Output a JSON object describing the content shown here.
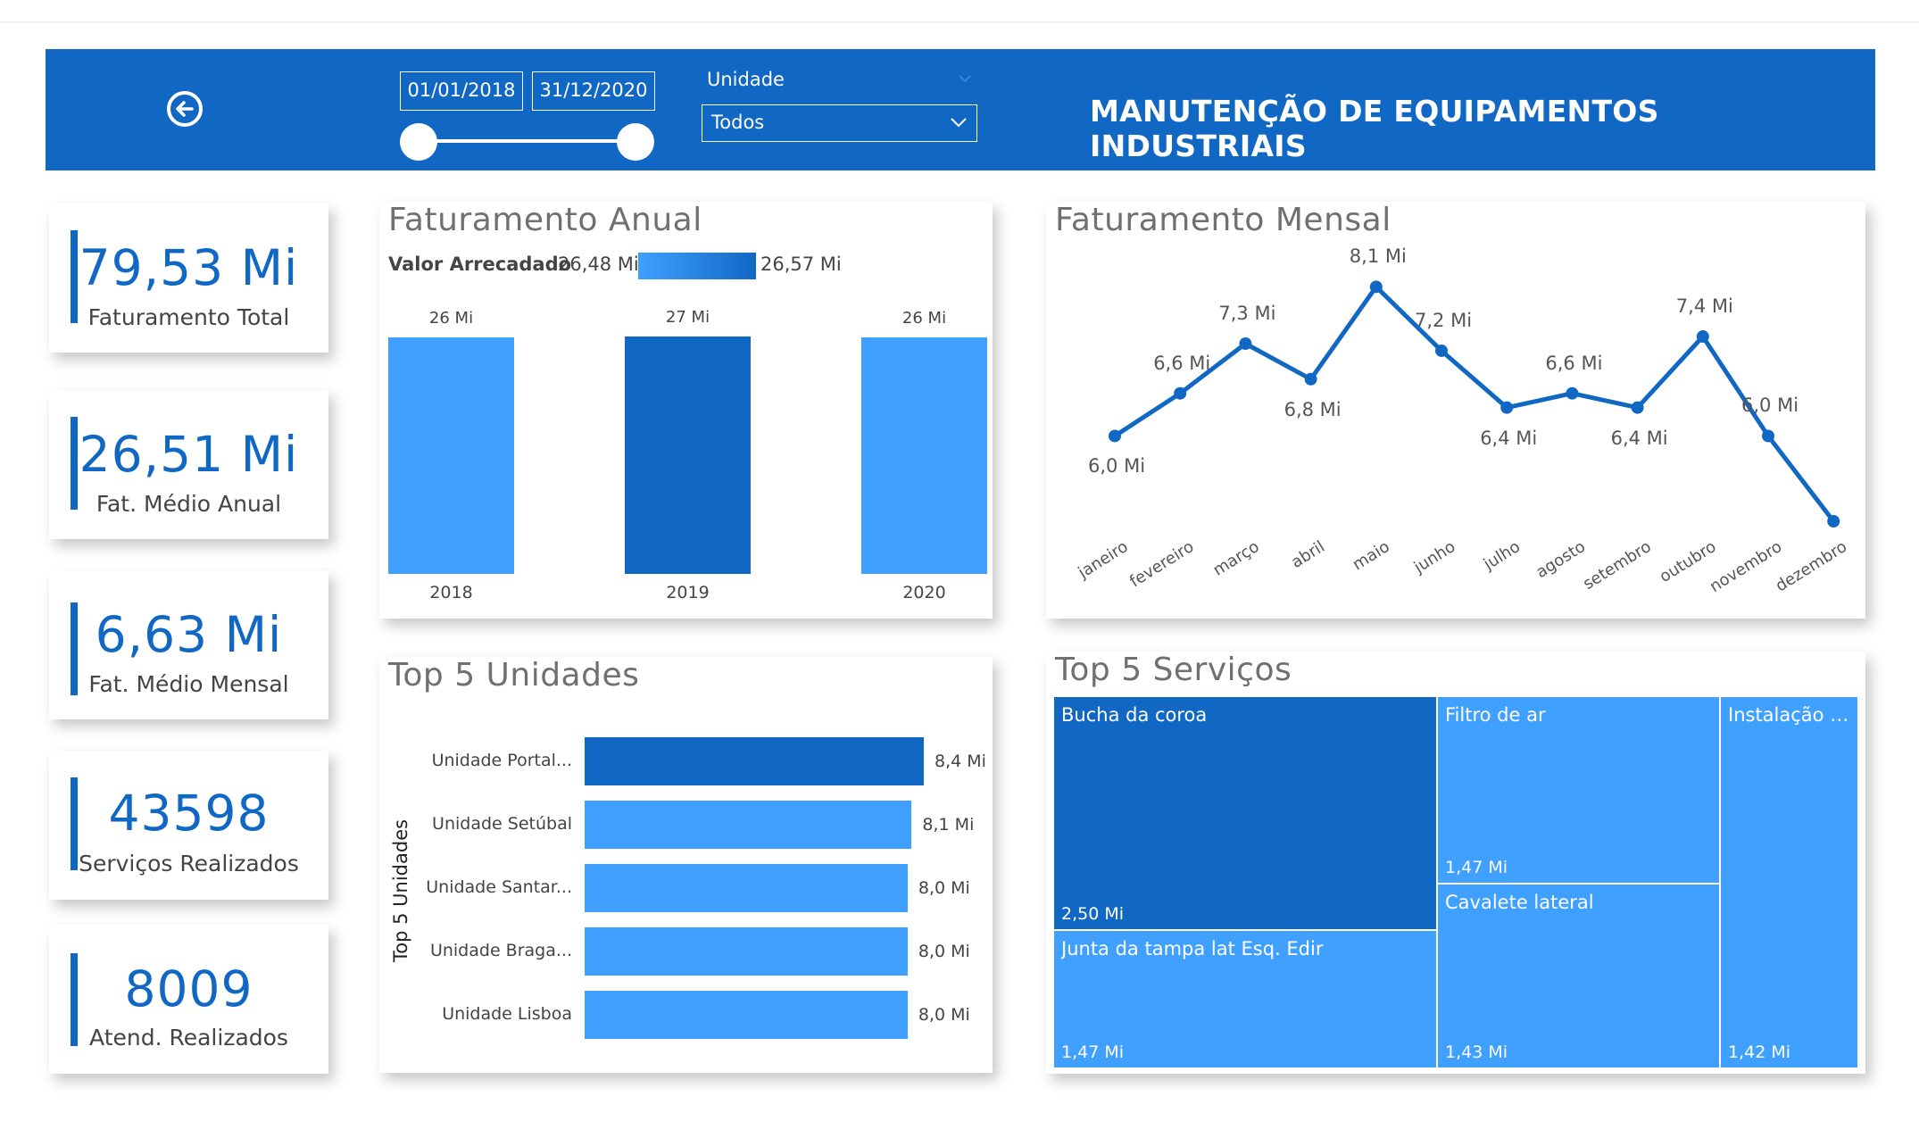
{
  "header": {
    "title": "MANUTENÇÃO DE EQUIPAMENTOS INDUSTRIAIS",
    "date_start": "01/01/2018",
    "date_end": "31/12/2020",
    "unit_label": "Unidade",
    "unit_value": "Todos"
  },
  "kpis": [
    {
      "value": "79,53 Mi",
      "label": "Faturamento Total"
    },
    {
      "value": "26,51 Mi",
      "label": "Fat. Médio Anual"
    },
    {
      "value": "6,63 Mi",
      "label": "Fat. Médio Mensal"
    },
    {
      "value": "43598",
      "label": "Serviços Realizados"
    },
    {
      "value": "8009",
      "label": "Atend. Realizados"
    }
  ],
  "colors": {
    "accent": "#1168c4",
    "bar_light": "#3fa0ff",
    "bar_dark": "#1168c4"
  },
  "annual": {
    "title": "Faturamento Anual",
    "legend_label": "Valor Arrecadado",
    "legend_min": "26,48 Mi",
    "legend_max": "26,57 Mi"
  },
  "monthly": {
    "title": "Faturamento Mensal"
  },
  "units": {
    "title": "Top 5 Unidades",
    "axis_label": "Top 5 Unidades"
  },
  "services": {
    "title": "Top 5 Serviços"
  },
  "chart_data": [
    {
      "type": "bar",
      "title": "Faturamento Anual",
      "categories": [
        "2018",
        "2019",
        "2020"
      ],
      "values": [
        26.48,
        26.57,
        26.48
      ],
      "data_labels": [
        "26 Mi",
        "27 Mi",
        "26 Mi"
      ],
      "ylim": [
        0,
        27
      ]
    },
    {
      "type": "line",
      "title": "Faturamento Mensal",
      "x": [
        "janeiro",
        "fevereiro",
        "março",
        "abril",
        "maio",
        "junho",
        "julho",
        "agosto",
        "setembro",
        "outubro",
        "novembro",
        "dezembro"
      ],
      "values": [
        6.0,
        6.6,
        7.3,
        6.8,
        8.1,
        7.2,
        6.4,
        6.6,
        6.4,
        7.4,
        6.0,
        4.8
      ],
      "data_labels": [
        "6,0 Mi",
        "6,6 Mi",
        "7,3 Mi",
        "6,8 Mi",
        "8,1 Mi",
        "7,2 Mi",
        "6,4 Mi",
        "6,6 Mi",
        "6,4 Mi",
        "7,4 Mi",
        "6,0 Mi",
        ""
      ]
    },
    {
      "type": "bar",
      "title": "Top 5 Unidades",
      "orientation": "horizontal",
      "ylabel": "Top 5 Unidades",
      "categories": [
        "Unidade Portal...",
        "Unidade Setúbal",
        "Unidade Santar...",
        "Unidade Braga...",
        "Unidade Lisboa"
      ],
      "values": [
        8.4,
        8.1,
        8.0,
        8.0,
        8.0
      ],
      "data_labels": [
        "8,4 Mi",
        "8,1 Mi",
        "8,0 Mi",
        "8,0 Mi",
        "8,0 Mi"
      ]
    },
    {
      "type": "treemap",
      "title": "Top 5 Serviços",
      "categories": [
        "Bucha da coroa",
        "Junta da tampa lat Esq. Edir",
        "Filtro de ar",
        "Cavalete lateral",
        "Instalação d..."
      ],
      "values": [
        2.5,
        1.47,
        1.47,
        1.43,
        1.42
      ],
      "data_labels": [
        "2,50 Mi",
        "1,47 Mi",
        "1,47 Mi",
        "1,43 Mi",
        "1,42 Mi"
      ]
    }
  ]
}
